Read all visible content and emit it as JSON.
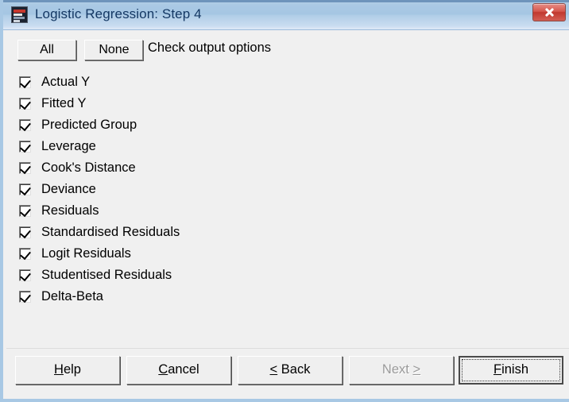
{
  "window": {
    "title": "Logistic Regression: Step 4",
    "icon": "app-icon",
    "close_icon": "close-icon",
    "accent_titlebar": "#a5c6e3",
    "accent_close": "#c1382f",
    "client_bg": "#f0f0f0"
  },
  "toolbar": {
    "all_label": "All",
    "none_label": "None",
    "instruction": "Check output options"
  },
  "options": [
    {
      "label": "Actual Y",
      "checked": true
    },
    {
      "label": "Fitted Y",
      "checked": true
    },
    {
      "label": "Predicted Group",
      "checked": true
    },
    {
      "label": "Leverage",
      "checked": true
    },
    {
      "label": "Cook's Distance",
      "checked": true
    },
    {
      "label": "Deviance",
      "checked": true
    },
    {
      "label": "Residuals",
      "checked": true
    },
    {
      "label": "Standardised Residuals",
      "checked": true
    },
    {
      "label": "Logit Residuals",
      "checked": true
    },
    {
      "label": "Studentised Residuals",
      "checked": true
    },
    {
      "label": "Delta-Beta",
      "checked": true
    }
  ],
  "buttons": {
    "help": {
      "mnemonic": "H",
      "rest": "elp",
      "prefix": "",
      "enabled": true,
      "default": false
    },
    "cancel": {
      "mnemonic": "C",
      "rest": "ancel",
      "prefix": "",
      "enabled": true,
      "default": false
    },
    "back": {
      "mnemonic": "<",
      "rest": " Back",
      "prefix": "",
      "enabled": true,
      "default": false
    },
    "next": {
      "mnemonic": ">",
      "rest": "",
      "prefix": "Next ",
      "enabled": false,
      "default": false
    },
    "finish": {
      "mnemonic": "F",
      "rest": "inish",
      "prefix": "",
      "enabled": true,
      "default": true
    }
  }
}
